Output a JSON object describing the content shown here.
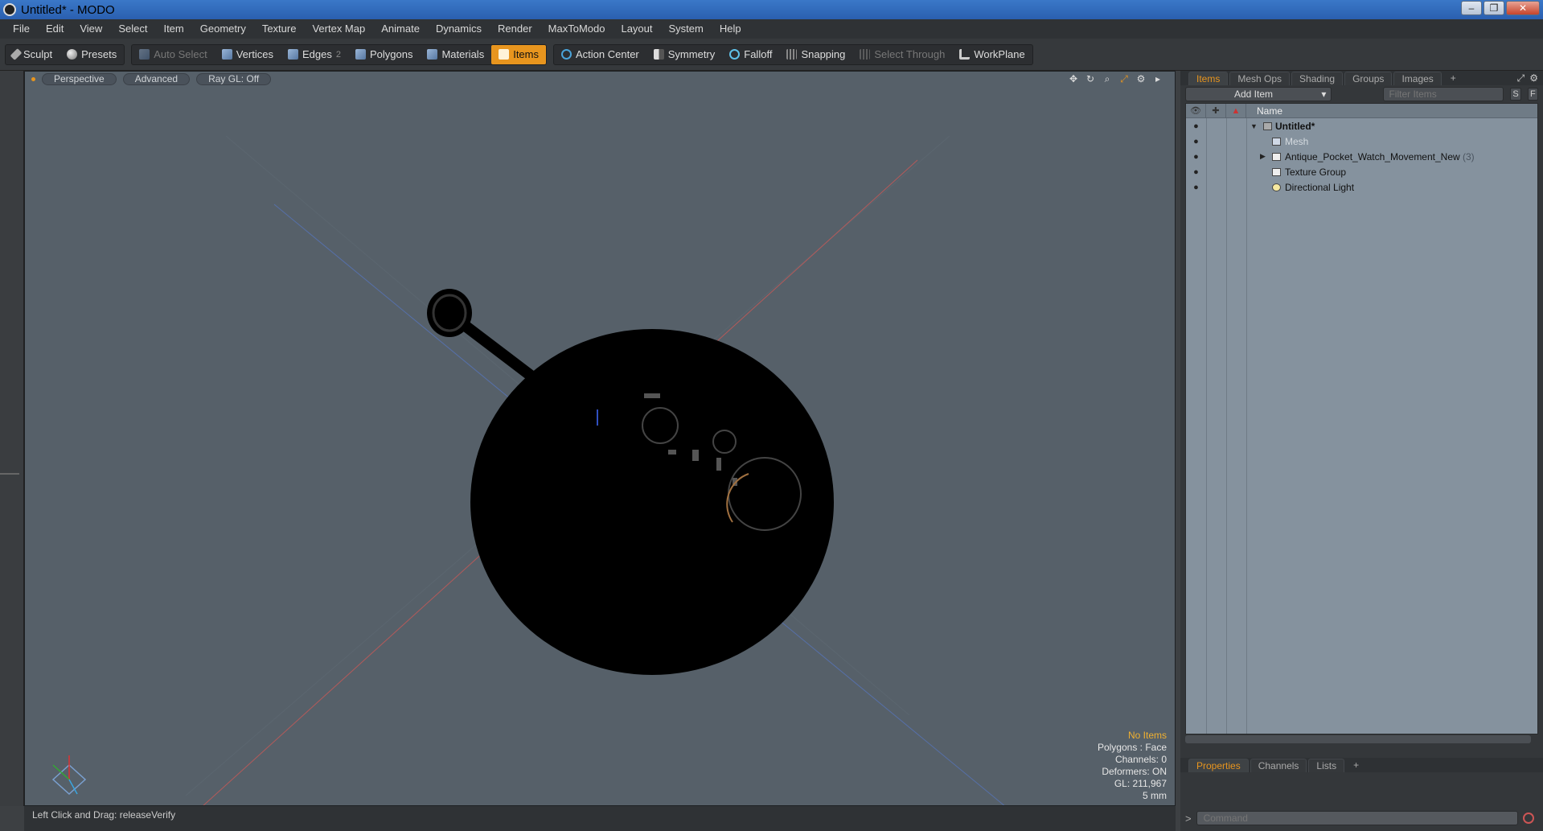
{
  "window": {
    "title": "Untitled* - MODO",
    "buttons": [
      "–",
      "❐",
      "✕"
    ]
  },
  "menu": [
    "File",
    "Edit",
    "View",
    "Select",
    "Item",
    "Geometry",
    "Texture",
    "Vertex Map",
    "Animate",
    "Dynamics",
    "Render",
    "MaxToModo",
    "Layout",
    "System",
    "Help"
  ],
  "toolbar": {
    "sculpt": "Sculpt",
    "presets": "Presets",
    "auto_select": "Auto Select",
    "vertices": "Vertices",
    "edges": "Edges",
    "edges_count": "2",
    "polygons": "Polygons",
    "materials": "Materials",
    "items": "Items",
    "action_center": "Action Center",
    "symmetry": "Symmetry",
    "falloff": "Falloff",
    "snapping": "Snapping",
    "select_through": "Select Through",
    "workplane": "WorkPlane"
  },
  "viewport": {
    "perspective": "Perspective",
    "advanced": "Advanced",
    "raygl": "Ray GL: Off",
    "info": {
      "no_items": "No Items",
      "polygons": "Polygons : Face",
      "channels": "Channels: 0",
      "deformers": "Deformers: ON",
      "gl": "GL: 211,967",
      "scale": "5 mm"
    },
    "axis_x": "X",
    "axis_y": "Y",
    "axis_z": "Z"
  },
  "status": {
    "text": "Left Click and Drag:  releaseVerify"
  },
  "items_panel": {
    "tabs": [
      "Items",
      "Mesh Ops",
      "Shading",
      "Groups",
      "Images",
      "+"
    ],
    "add_item": "Add Item",
    "filter_placeholder": "Filter Items",
    "s_btn": "S",
    "f_btn": "F",
    "name_header": "Name",
    "rows": [
      {
        "label": "Untitled*",
        "count": ""
      },
      {
        "label": "Mesh",
        "count": ""
      },
      {
        "label": "Antique_Pocket_Watch_Movement_New",
        "count": "(3)"
      },
      {
        "label": "Texture Group",
        "count": ""
      },
      {
        "label": "Directional Light",
        "count": ""
      }
    ]
  },
  "props_panel": {
    "tabs": [
      "Properties",
      "Channels",
      "Lists",
      "+"
    ],
    "command_placeholder": "Command",
    "prompt": ">"
  },
  "colors": {
    "accent": "#e8951e",
    "viewport_bg": "#566069",
    "tree_bg": "#85929e"
  }
}
